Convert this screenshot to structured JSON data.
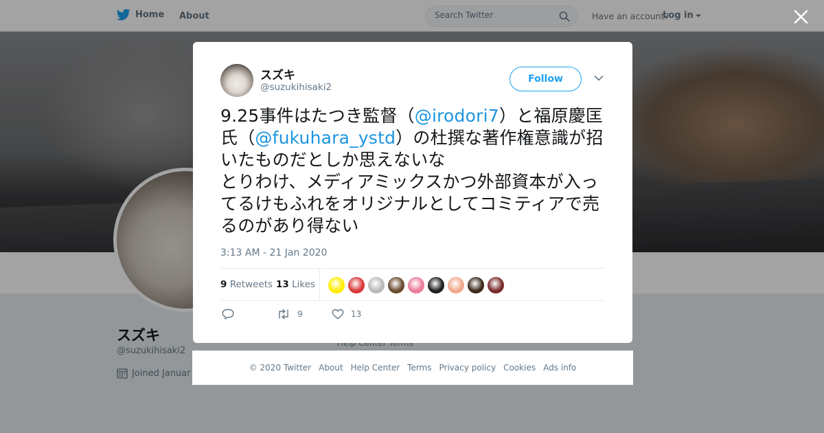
{
  "topbar": {
    "home_label": "Home",
    "about_label": "About",
    "search_placeholder": "Search Twitter",
    "have_account_label": "Have an account?",
    "login_label": "Log in"
  },
  "profile": {
    "name": "スズキ",
    "handle": "@suzukihisaki2",
    "joined_prefix": "Joined Januar",
    "links": "Help Center   Terms"
  },
  "tweet": {
    "author_name": "スズキ",
    "author_handle": "@suzukihisaki2",
    "follow_label": "Follow",
    "text_parts": {
      "p1": "9.25事件はたつき監督（",
      "m1": "@irodori7",
      "p2": "）と福原慶匡氏（",
      "m2": "@fukuhara_ystd",
      "p3": "）の杜撰な著作権意識が招いたものだとしか思えないな",
      "p4": "とりわけ、メディアミックスかつ外部資本が入ってるけもふれをオリジナルとしてコミティアで売るのがあり得ない"
    },
    "timestamp": "3:13 AM - 21 Jan 2020",
    "retweets_count": "9",
    "retweets_label": "Retweets",
    "likes_count": "13",
    "likes_label": "Likes",
    "likers": [
      {
        "color": "#ffee00"
      },
      {
        "color": "#d9383a"
      },
      {
        "color": "#b9b9b9"
      },
      {
        "color": "#6a4a2e"
      },
      {
        "color": "#ec7a9a"
      },
      {
        "color": "#1f1f1f"
      },
      {
        "color": "#f0a88a"
      },
      {
        "color": "#3c2a1a"
      },
      {
        "color": "#7a2a2a"
      }
    ],
    "actions": {
      "reply_icon": "reply-icon",
      "retweet_count": "9",
      "like_count": "13"
    }
  },
  "footer": {
    "copyright": "© 2020 Twitter",
    "about": "About",
    "help_center": "Help Center",
    "terms": "Terms",
    "privacy": "Privacy policy",
    "cookies": "Cookies",
    "ads_info": "Ads info"
  },
  "colors": {
    "brand_blue": "#1da1f2",
    "mention_blue": "#1b95e0"
  }
}
